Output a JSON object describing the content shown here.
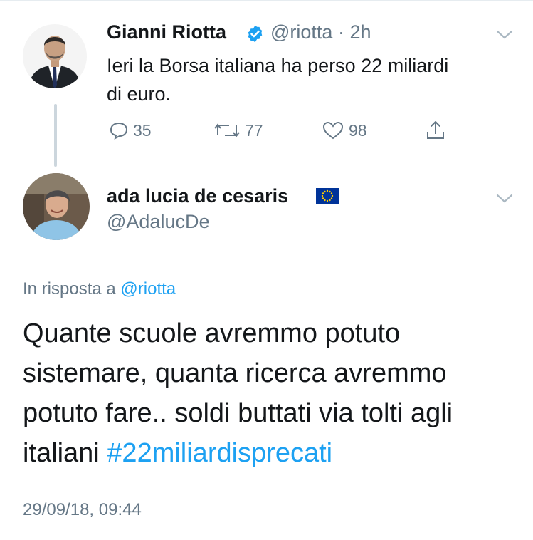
{
  "tweet1": {
    "name": "Gianni Riotta",
    "handle": "@riotta",
    "time": "· 2h",
    "text_line1": "Ieri la Borsa italiana ha perso 22 miliardi",
    "text_line2": "di euro.",
    "actions": {
      "replies": "35",
      "retweets": "77",
      "likes": "98"
    }
  },
  "tweet2": {
    "name": "ada lucia de cesaris",
    "handle": "@AdalucDe",
    "reply_prefix": "In risposta a",
    "reply_handle": "@riotta",
    "body_lines": [
      "Quante scuole avremmo potuto",
      "sistemare, quanta ricerca avremmo",
      "potuto fare.. soldi buttati via tolti agli",
      "italiani"
    ],
    "hashtag": "#22miliardisprecati",
    "timestamp": "29/09/18, 09:44"
  },
  "colors": {
    "link": "#1da1f2",
    "muted": "#657786",
    "text": "#14171a",
    "eu_blue": "#003399",
    "eu_star": "#ffcc00"
  },
  "icons": [
    "verified-badge-icon",
    "chevron-down-icon",
    "reply-icon",
    "retweet-icon",
    "like-icon",
    "share-icon",
    "eu-flag-icon"
  ]
}
